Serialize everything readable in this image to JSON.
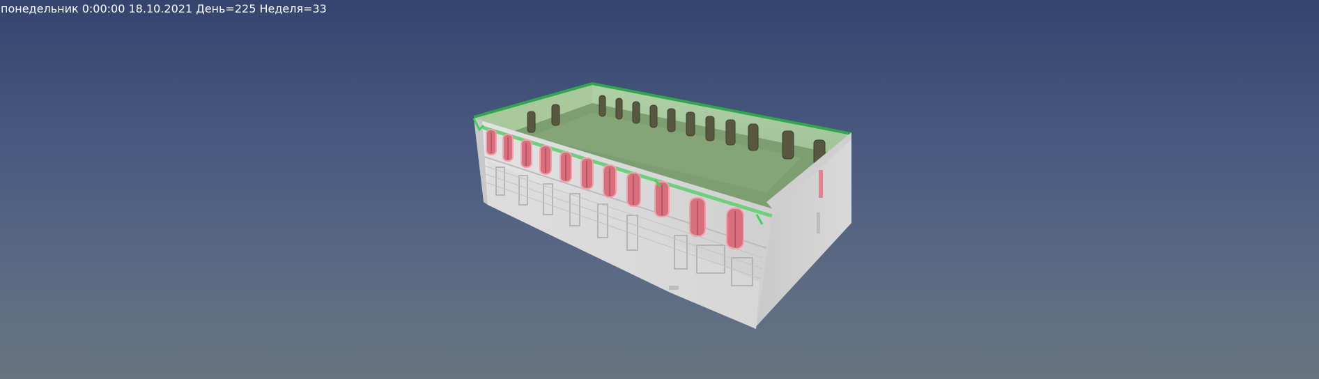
{
  "hud": {
    "status_text": "понедельник 0:00:00 18.10.2021 День=225 Неделя=33"
  },
  "scene": {
    "background_top": "#34446f",
    "background_bottom": "#67757f",
    "roof_color": "#7c9e70",
    "highlight_green": "#33cc44",
    "highlight_red": "#e05a6a",
    "wall_color": "#d6d6d6"
  }
}
